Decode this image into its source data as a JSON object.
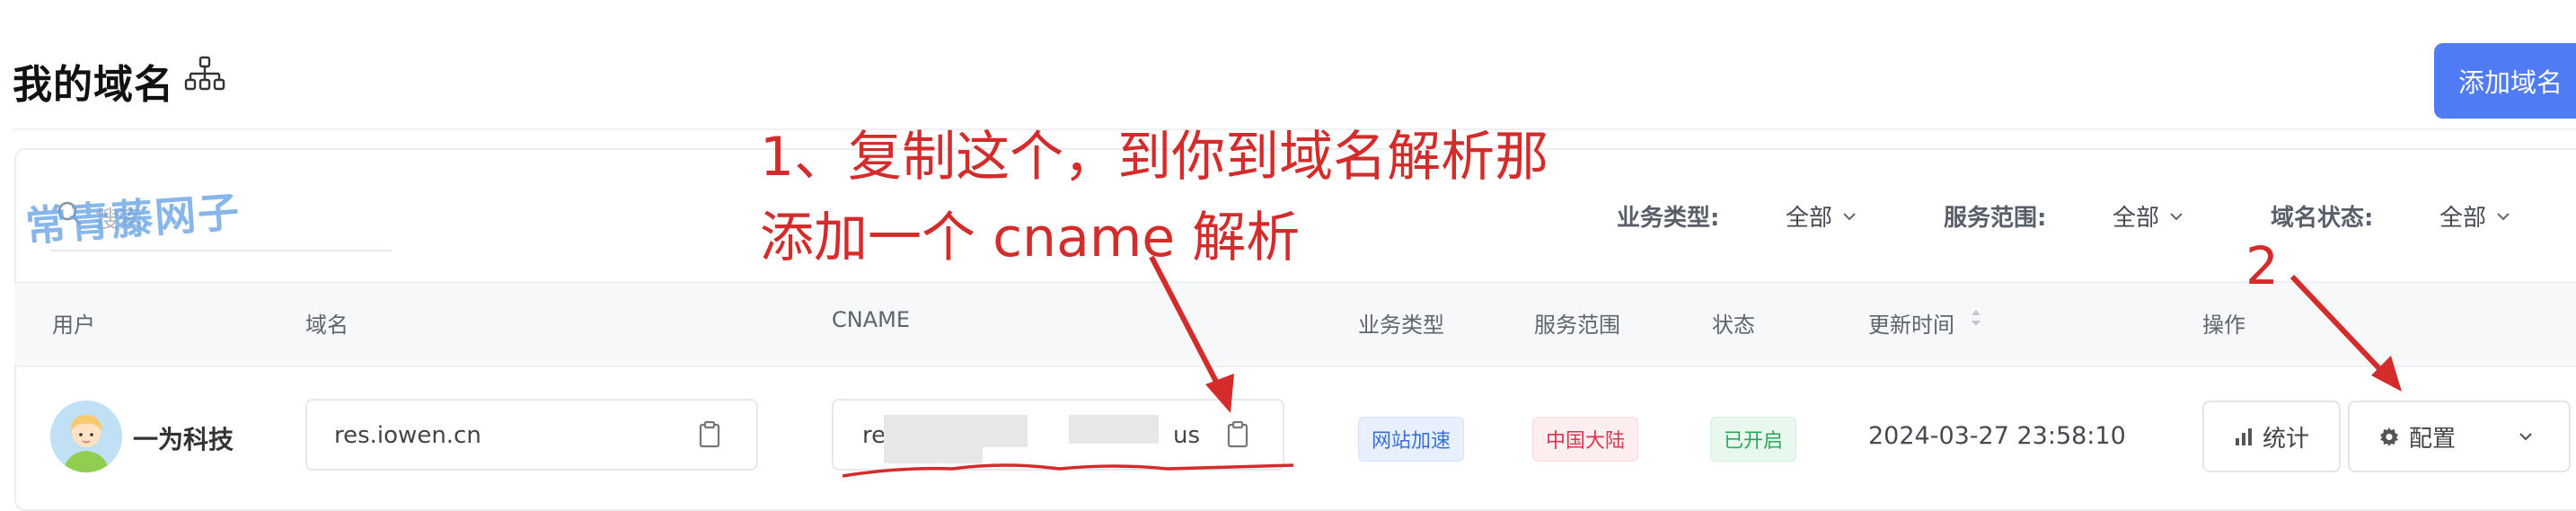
{
  "header": {
    "title": "我的域名",
    "add_button_label": "添加域名"
  },
  "search": {
    "placeholder": "搜索"
  },
  "watermark": "常青藤网子",
  "filters": [
    {
      "label": "业务类型:",
      "value": "全部"
    },
    {
      "label": "服务范围:",
      "value": "全部"
    },
    {
      "label": "域名状态:",
      "value": "全部"
    }
  ],
  "table": {
    "columns": [
      "用户",
      "域名",
      "CNAME",
      "业务类型",
      "服务范围",
      "状态",
      "更新时间",
      "操作"
    ],
    "rows": [
      {
        "user": "一为科技",
        "domain": "res.iowen.cn",
        "cname_start": "re",
        "cname_end": "us",
        "business_type": "网站加速",
        "service_scope": "中国大陆",
        "status": "已开启",
        "updated": "2024-03-27 23:58:10",
        "actions": {
          "stats": "统计",
          "config": "配置"
        }
      }
    ]
  },
  "annotations": {
    "line1": "1、复制这个，到你到域名解析那",
    "line2": "添加一个 cname 解析",
    "step2": "2"
  },
  "colors": {
    "primary": "#4f7cf5",
    "annotation": "#d42b2b"
  }
}
